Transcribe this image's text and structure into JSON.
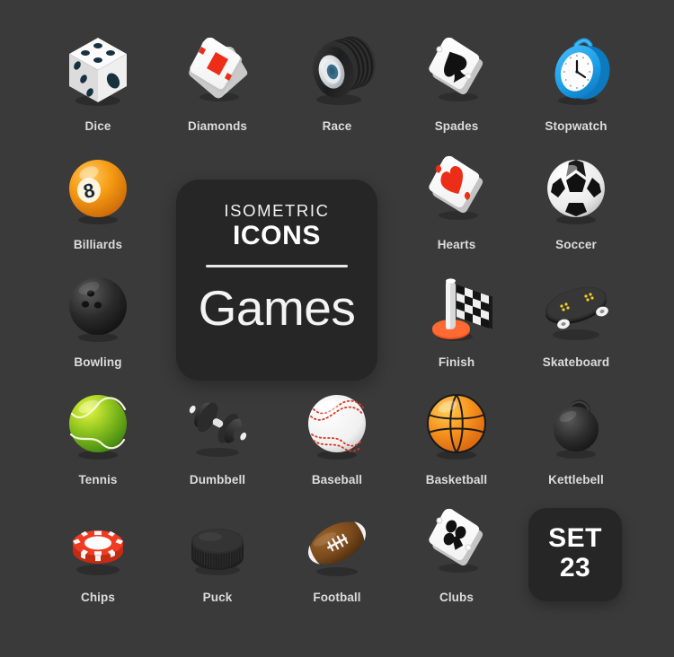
{
  "sheet": {
    "background_color": "#3a3a3a",
    "label_color": "#dcdcdc",
    "card_color": "#262626"
  },
  "title_card": {
    "eyebrow_top": "ISOMETRIC",
    "eyebrow_bottom": "ICONS",
    "set_name": "Games"
  },
  "set_badge": {
    "word": "SET",
    "number": "23"
  },
  "icons": [
    {
      "name": "dice",
      "label": "Dice",
      "icon": "dice-icon",
      "col": 0,
      "row": 0
    },
    {
      "name": "diamonds",
      "label": "Diamonds",
      "icon": "diamonds-card-icon",
      "col": 1,
      "row": 0
    },
    {
      "name": "race",
      "label": "Race",
      "icon": "race-tire-icon",
      "col": 2,
      "row": 0
    },
    {
      "name": "spades",
      "label": "Spades",
      "icon": "spades-card-icon",
      "col": 3,
      "row": 0
    },
    {
      "name": "stopwatch",
      "label": "Stopwatch",
      "icon": "stopwatch-icon",
      "col": 4,
      "row": 0
    },
    {
      "name": "billiards",
      "label": "Billiards",
      "icon": "billiards-ball-icon",
      "col": 0,
      "row": 1
    },
    {
      "name": "hearts",
      "label": "Hearts",
      "icon": "hearts-card-icon",
      "col": 3,
      "row": 1
    },
    {
      "name": "soccer",
      "label": "Soccer",
      "icon": "soccer-ball-icon",
      "col": 4,
      "row": 1
    },
    {
      "name": "bowling",
      "label": "Bowling",
      "icon": "bowling-ball-icon",
      "col": 0,
      "row": 2
    },
    {
      "name": "finish",
      "label": "Finish",
      "icon": "finish-flag-icon",
      "col": 3,
      "row": 2
    },
    {
      "name": "skateboard",
      "label": "Skateboard",
      "icon": "skateboard-icon",
      "col": 4,
      "row": 2
    },
    {
      "name": "tennis",
      "label": "Tennis",
      "icon": "tennis-ball-icon",
      "col": 0,
      "row": 3
    },
    {
      "name": "dumbbell",
      "label": "Dumbbell",
      "icon": "dumbbell-icon",
      "col": 1,
      "row": 3
    },
    {
      "name": "baseball",
      "label": "Baseball",
      "icon": "baseball-icon",
      "col": 2,
      "row": 3
    },
    {
      "name": "basketball",
      "label": "Basketball",
      "icon": "basketball-icon",
      "col": 3,
      "row": 3
    },
    {
      "name": "kettlebell",
      "label": "Kettlebell",
      "icon": "kettlebell-icon",
      "col": 4,
      "row": 3
    },
    {
      "name": "chips",
      "label": "Chips",
      "icon": "poker-chip-icon",
      "col": 0,
      "row": 4
    },
    {
      "name": "puck",
      "label": "Puck",
      "icon": "hockey-puck-icon",
      "col": 1,
      "row": 4
    },
    {
      "name": "football",
      "label": "Football",
      "icon": "football-icon",
      "col": 2,
      "row": 4
    },
    {
      "name": "clubs",
      "label": "Clubs",
      "icon": "clubs-card-icon",
      "col": 3,
      "row": 4
    }
  ],
  "palette": {
    "dice_pip": "#17313f",
    "card_red": "#ec2d18",
    "stopwatch_blue": "#1b9ee8",
    "billiards_orange": "#f59a13",
    "finish_orange": "#f4511e",
    "tennis_green": "#8ec31f",
    "basketball_orange": "#f7941e",
    "football_brown": "#7a4a1d",
    "chip_red": "#ef3b21",
    "skate_yellow": "#f5d020",
    "dark_rubber": "#2c2c2c"
  }
}
